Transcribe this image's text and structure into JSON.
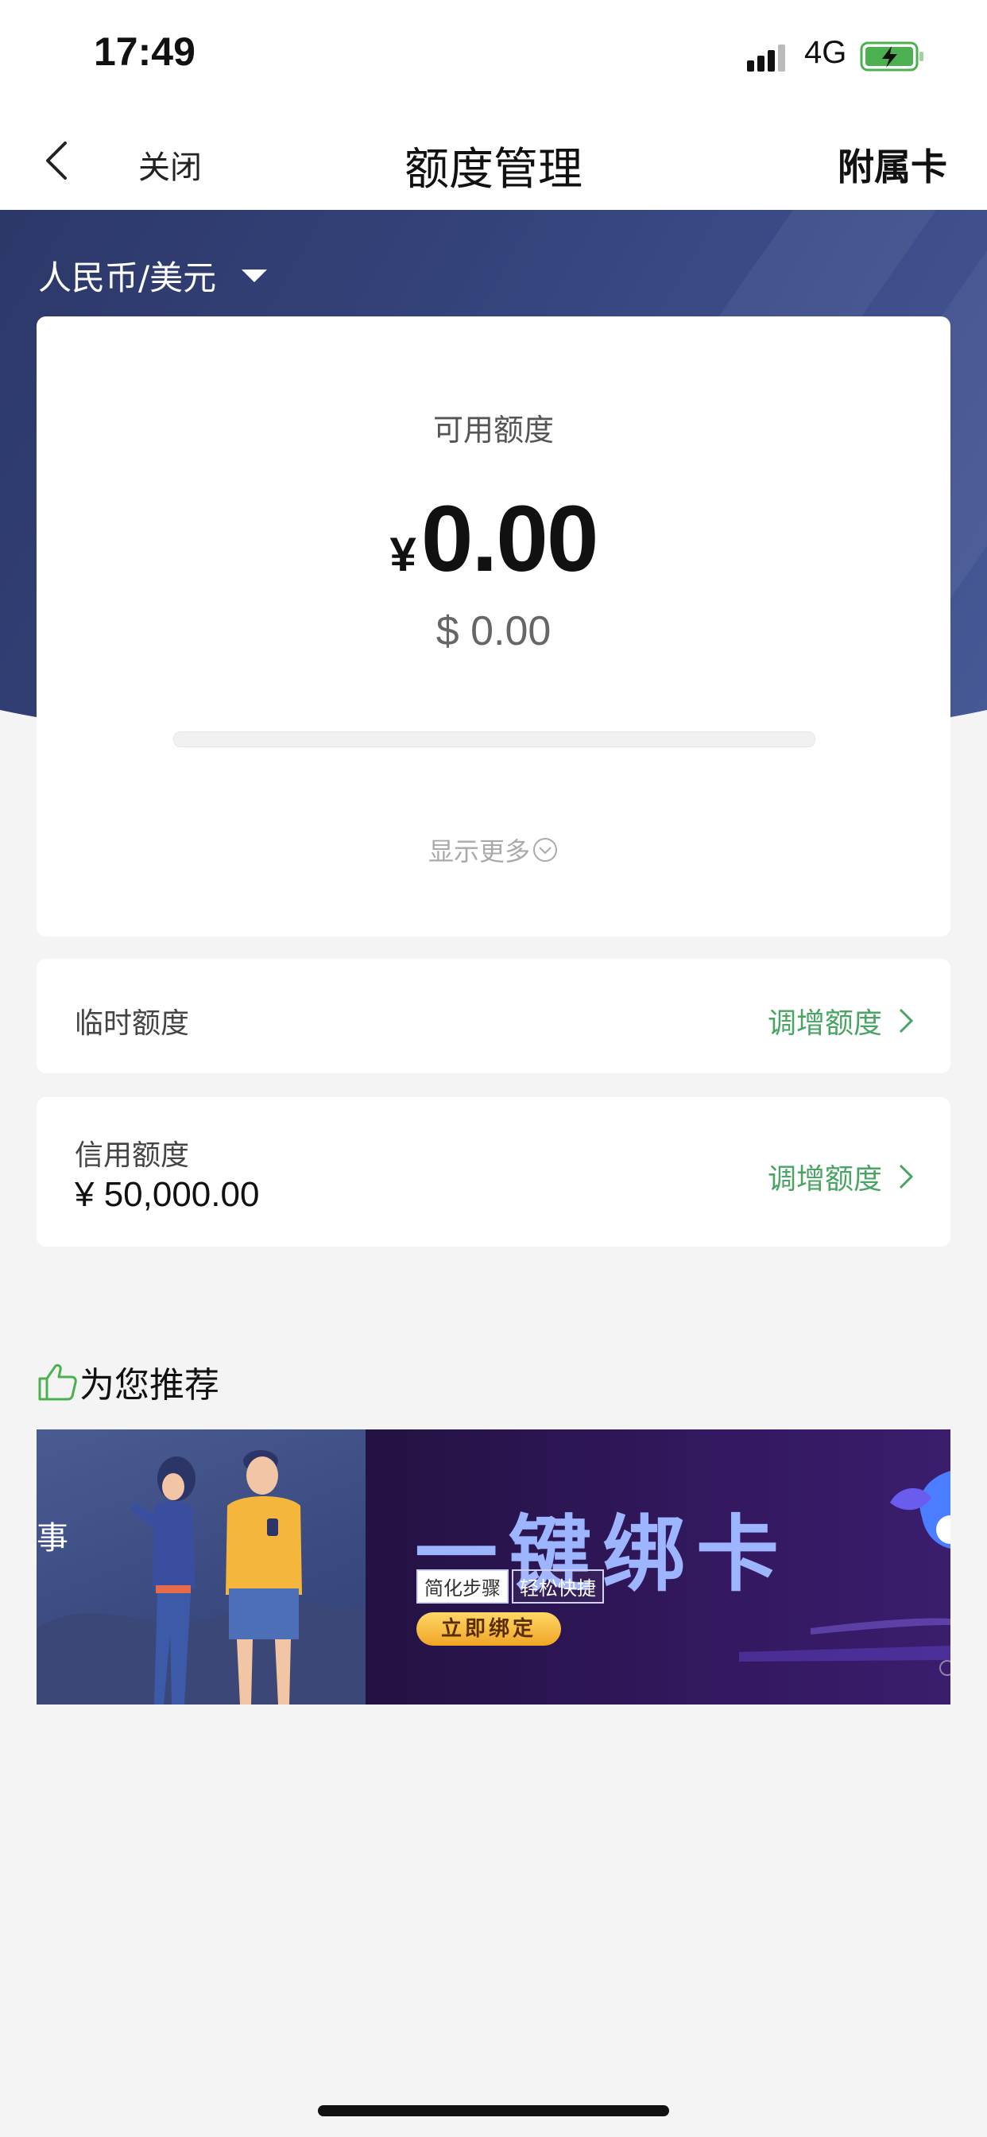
{
  "status_bar": {
    "time": "17:49",
    "network": "4G"
  },
  "nav": {
    "close_label": "关闭",
    "title": "额度管理",
    "right_label": "附属卡"
  },
  "header": {
    "currency_selector": "人民币/美元"
  },
  "available": {
    "label": "可用额度",
    "cny_symbol": "¥",
    "cny_amount": "0.00",
    "usd_text": "$ 0.00",
    "used_fraction": 0,
    "show_more": "显示更多"
  },
  "rows": {
    "temporary": {
      "label": "临时额度",
      "action": "调增额度"
    },
    "credit": {
      "label": "信用额度",
      "value": "¥ 50,000.00",
      "action": "调增额度"
    }
  },
  "recommend": {
    "title": "为您推荐",
    "banner": {
      "headline": "一键绑卡",
      "tag1": "简化步骤",
      "tag2": "轻松快捷",
      "button": "立即绑定",
      "left_edge_text": "事",
      "active_dot": 2
    }
  },
  "colors": {
    "accent_green": "#4aa564",
    "header_blue": "#34427a"
  }
}
